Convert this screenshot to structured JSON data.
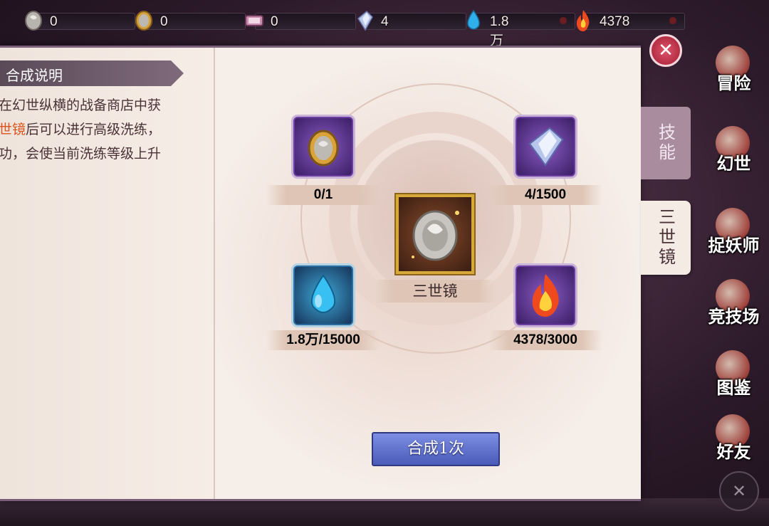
{
  "resources": [
    {
      "icon": "silver-mirror-icon",
      "value": "0"
    },
    {
      "icon": "gold-mirror-icon",
      "value": "0"
    },
    {
      "icon": "scroll-icon",
      "value": "0"
    },
    {
      "icon": "crystal-icon",
      "value": "4"
    },
    {
      "icon": "water-drop-icon",
      "value": "1.8万"
    },
    {
      "icon": "flame-icon",
      "value": "4378"
    }
  ],
  "right_menu": [
    {
      "label": "冒险"
    },
    {
      "label": "幻世"
    },
    {
      "label": "捉妖师"
    },
    {
      "label": "竞技场"
    },
    {
      "label": "图鉴"
    },
    {
      "label": "好友"
    }
  ],
  "left_panel": {
    "title": "合成说明",
    "desc_line1": "在幻世纵横的战备商店中获",
    "desc_line2_highlight": "世镜",
    "desc_line2_rest": "后可以进行高级洗练，",
    "desc_line3": "功，会使当前洗练等级上升"
  },
  "materials": {
    "top_left": {
      "icon": "gold-mirror-icon",
      "count": "0/1",
      "status": "insufficient"
    },
    "top_right": {
      "icon": "crystal-icon",
      "count": "4/1500",
      "status": "insufficient"
    },
    "bottom_left": {
      "icon": "water-drop-icon",
      "count": "1.8万/15000",
      "status": "sufficient"
    },
    "bottom_right": {
      "icon": "flame-icon",
      "count": "4378/3000",
      "status": "sufficient"
    }
  },
  "target_item": {
    "icon": "silver-mirror-icon",
    "name": "三世镜"
  },
  "synth_button": "合成1次",
  "tabs": [
    {
      "label": "技能",
      "active": false
    },
    {
      "label": "三世镜",
      "active": true
    }
  ],
  "colors": {
    "insufficient": "#b03a2a",
    "sufficient": "#2f7a24",
    "highlight": "#d8541c",
    "button": "#5b6cc9"
  }
}
